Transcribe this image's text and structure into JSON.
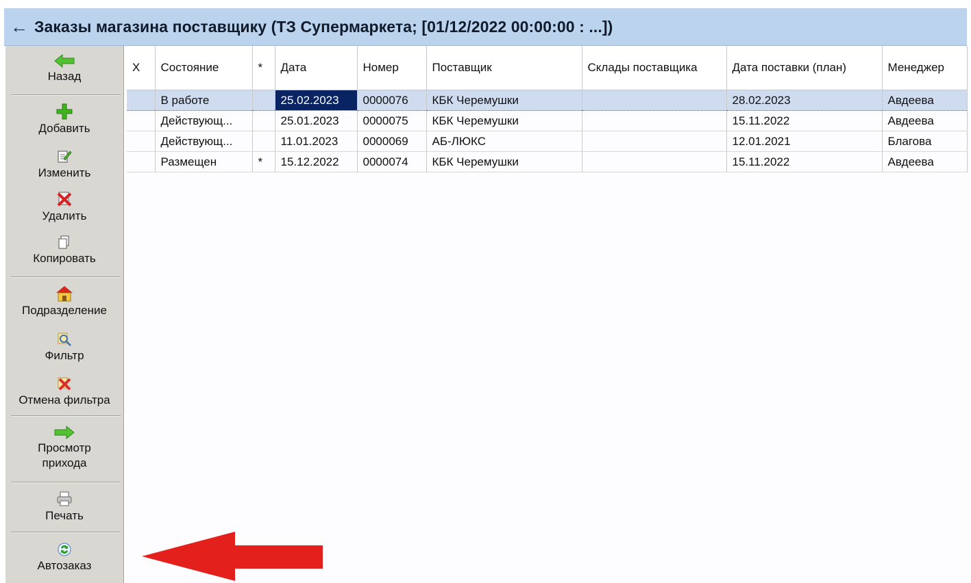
{
  "window": {
    "back_glyph": "←",
    "title": "Заказы магазина поставщику (ТЗ Супермаркета; [01/12/2022 00:00:00 : ...])"
  },
  "toolbar": {
    "back": "Назад",
    "add": "Добавить",
    "edit": "Изменить",
    "delete": "Удалить",
    "copy": "Копировать",
    "department": "Подразделение",
    "filter": "Фильтр",
    "cancel_filter": "Отмена фильтра",
    "view_receipt_line1": "Просмотр",
    "view_receipt_line2": "прихода",
    "print": "Печать",
    "autoorder": "Автозаказ"
  },
  "table": {
    "columns": [
      "X",
      "Состояние",
      "*",
      "Дата",
      "Номер",
      "Поставщик",
      "Склады поставщика",
      "Дата поставки (план)",
      "Менеджер"
    ],
    "rows": [
      {
        "x": "",
        "state": "В работе",
        "star": "",
        "date": "25.02.2023",
        "number": "0000076",
        "supplier": "КБК Черемушки",
        "warehouses": "",
        "delivery": "28.02.2023",
        "manager": "Авдеева"
      },
      {
        "x": "",
        "state": "Действующ...",
        "star": "",
        "date": "25.01.2023",
        "number": "0000075",
        "supplier": "КБК Черемушки",
        "warehouses": "",
        "delivery": "15.11.2022",
        "manager": "Авдеева"
      },
      {
        "x": "",
        "state": "Действующ...",
        "star": "",
        "date": "11.01.2023",
        "number": "0000069",
        "supplier": "АБ-ЛЮКС",
        "warehouses": "",
        "delivery": "12.01.2021",
        "manager": "Благова"
      },
      {
        "x": "",
        "state": "Размещен",
        "star": "*",
        "date": "15.12.2022",
        "number": "0000074",
        "supplier": "КБК Черемушки",
        "warehouses": "",
        "delivery": "15.11.2022",
        "manager": "Авдеева"
      }
    ]
  },
  "colors": {
    "title_bg": "#bcd3ee",
    "selected_row": "#cfdcf0",
    "current_cell": "#0a2463",
    "annotation_arrow": "#e3201b"
  }
}
